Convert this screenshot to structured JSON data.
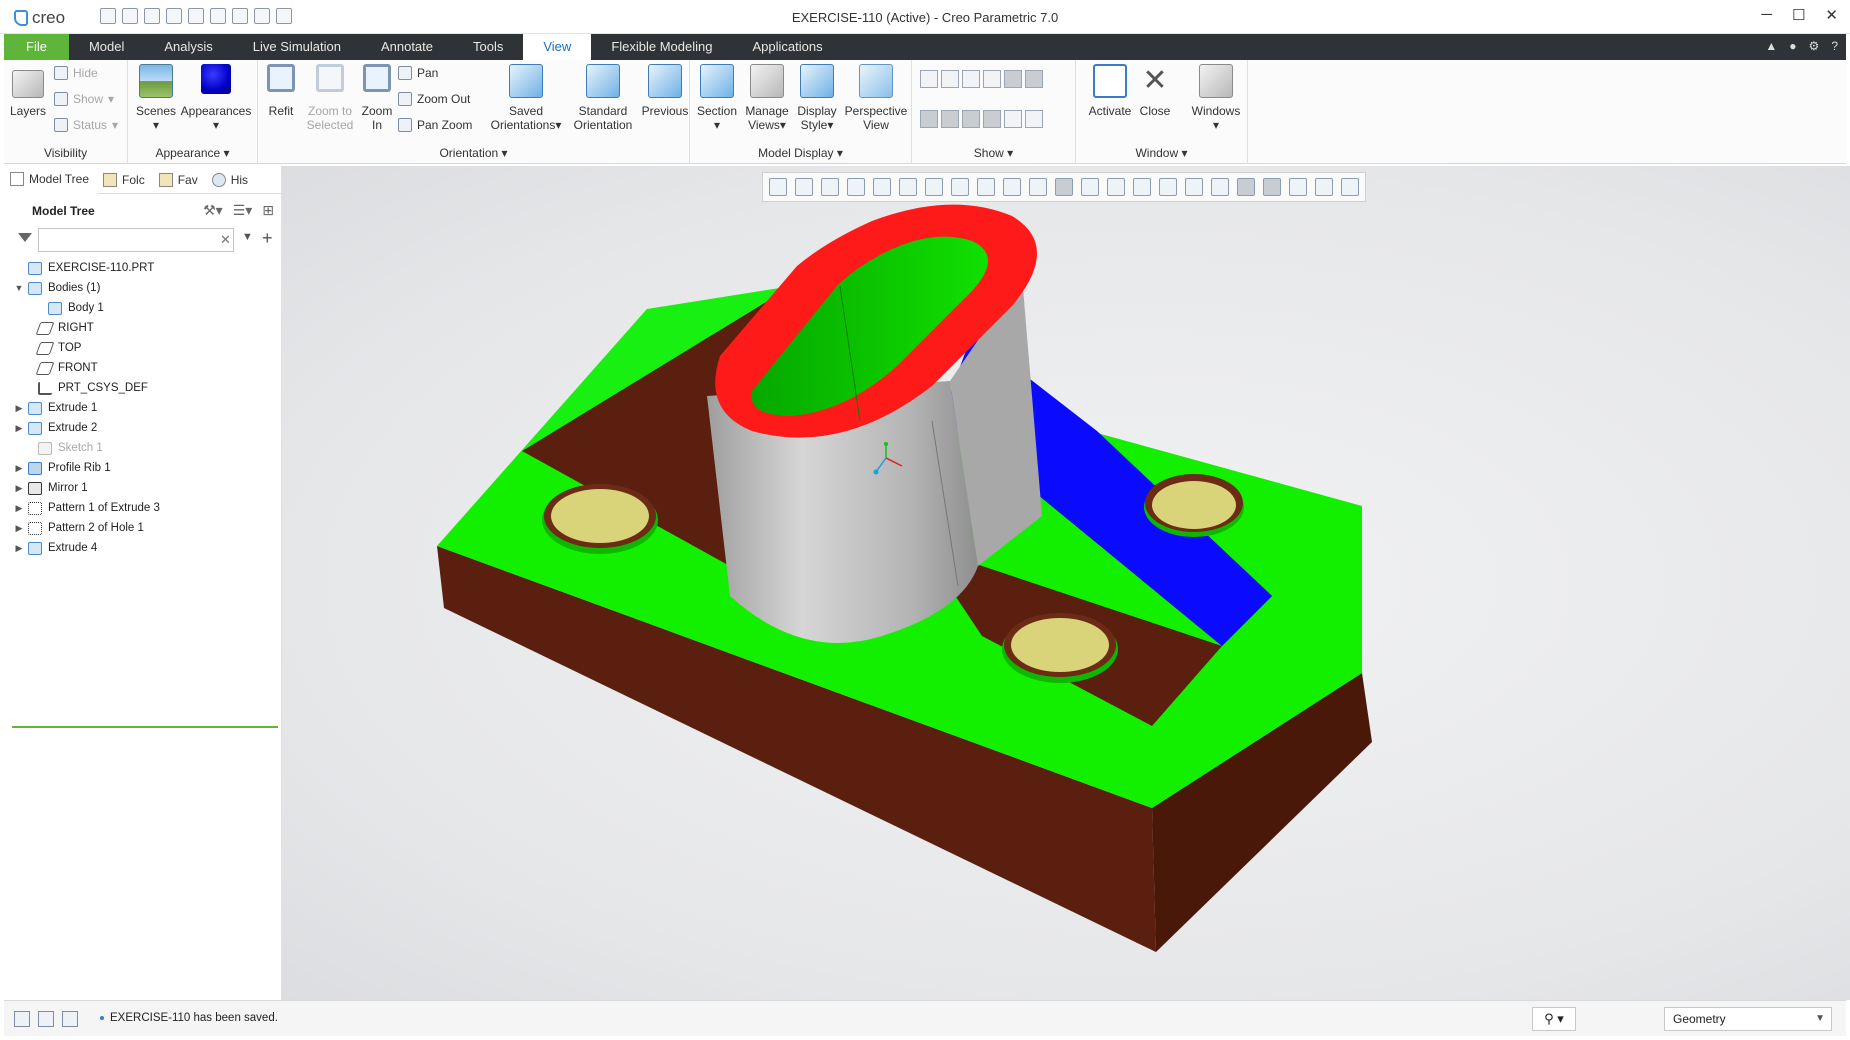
{
  "app": {
    "brand": "creo",
    "window_title": "EXERCISE-110 (Active) - Creo Parametric 7.0",
    "controls": [
      "─",
      "☐",
      "✕"
    ]
  },
  "tabs": [
    "File",
    "Model",
    "Analysis",
    "Live Simulation",
    "Annotate",
    "Tools",
    "View",
    "Flexible Modeling",
    "Applications"
  ],
  "active_tab": "View",
  "ribbon": {
    "visibility": {
      "label": "Visibility",
      "layers": "Layers",
      "hide": "Hide",
      "show": "Show",
      "status": "Status"
    },
    "appearance": {
      "label": "Appearance",
      "scenes": "Scenes",
      "appearances": "Appearances"
    },
    "orientation": {
      "label": "Orientation",
      "refit": "Refit",
      "zoom_to_selected_1": "Zoom to",
      "zoom_to_selected_2": "Selected",
      "zoom_in_1": "Zoom",
      "zoom_in_2": "In",
      "pan": "Pan",
      "zoom_out": "Zoom Out",
      "pan_zoom": "Pan Zoom",
      "saved_1": "Saved",
      "saved_2": "Orientations",
      "standard_1": "Standard",
      "standard_2": "Orientation",
      "previous": "Previous"
    },
    "model_display": {
      "label": "Model Display",
      "section": "Section",
      "manage_1": "Manage",
      "manage_2": "Views",
      "display_1": "Display",
      "display_2": "Style",
      "perspective_1": "Perspective",
      "perspective_2": "View"
    },
    "show": {
      "label": "Show"
    },
    "window": {
      "label": "Window",
      "activate": "Activate",
      "close": "Close",
      "windows": "Windows"
    }
  },
  "panel": {
    "tabs": [
      "Model Tree",
      "Folc",
      "Fav",
      "His"
    ],
    "tree_title": "Model Tree",
    "filter_placeholder": "",
    "items": [
      {
        "label": "EXERCISE-110.PRT",
        "icon": "part-icon",
        "arrow": "",
        "indent": 0
      },
      {
        "label": "Bodies (1)",
        "icon": "bodies-icon",
        "arrow": "▼",
        "indent": 0
      },
      {
        "label": "Body 1",
        "icon": "body-icon",
        "arrow": "",
        "indent": 2
      },
      {
        "label": "RIGHT",
        "icon": "plane-icon",
        "arrow": "",
        "indent": 1
      },
      {
        "label": "TOP",
        "icon": "plane-icon",
        "arrow": "",
        "indent": 1
      },
      {
        "label": "FRONT",
        "icon": "plane-icon",
        "arrow": "",
        "indent": 1
      },
      {
        "label": "PRT_CSYS_DEF",
        "icon": "csys-icon",
        "arrow": "",
        "indent": 1
      },
      {
        "label": "Extrude 1",
        "icon": "extrude-icon",
        "arrow": "▶",
        "indent": 0
      },
      {
        "label": "Extrude 2",
        "icon": "extrude-icon",
        "arrow": "▶",
        "indent": 0
      },
      {
        "label": "Sketch 1",
        "icon": "sketch-icon",
        "arrow": "",
        "indent": 1,
        "dim": true
      },
      {
        "label": "Profile Rib 1",
        "icon": "rib-icon",
        "arrow": "▶",
        "indent": 0
      },
      {
        "label": "Mirror 1",
        "icon": "mirror-icon",
        "arrow": "▶",
        "indent": 0
      },
      {
        "label": "Pattern 1 of Extrude 3",
        "icon": "pattern-icon",
        "arrow": "▶",
        "indent": 0
      },
      {
        "label": "Pattern 2 of Hole 1",
        "icon": "pattern-icon",
        "arrow": "▶",
        "indent": 0
      },
      {
        "label": "Extrude 4",
        "icon": "extrude-icon",
        "arrow": "▶",
        "indent": 0
      }
    ]
  },
  "status": {
    "message": "EXERCISE-110 has been saved.",
    "filter_value": "Geometry"
  },
  "colors": {
    "file_tab": "#5eb539",
    "tab_bar": "#2f3236",
    "active_tab_text": "#1a6fc3",
    "face_green": "#12f000",
    "face_brown": "#5a1f0e",
    "face_red": "#ff1a1a",
    "face_blue": "#0a0aff",
    "hole_yellow": "#d9d47a",
    "cylinder_grey": "#b9b9b9"
  }
}
